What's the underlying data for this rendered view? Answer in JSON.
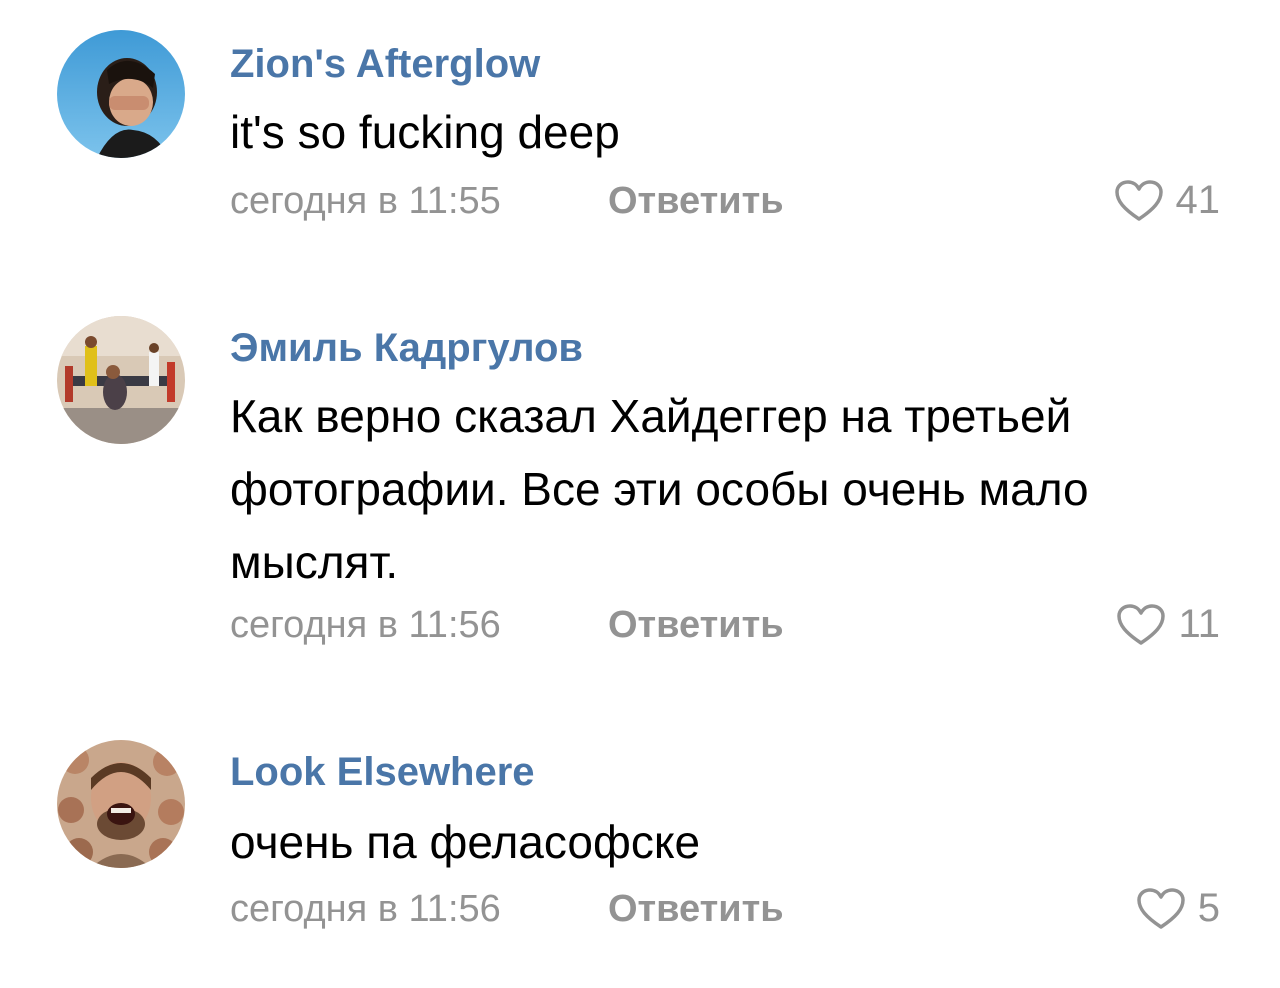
{
  "comments": [
    {
      "author": "Zion's Afterglow",
      "text": "it's so fucking deep",
      "time": "сегодня в 11:55",
      "reply_label": "Ответить",
      "likes": "41",
      "avatar": "avatar-photo-person-covering-face"
    },
    {
      "author": "Эмиль Кадргулов",
      "text": "Как верно сказал Хайдеггер на третьей фотографии. Все эти особы очень мало мыслят.",
      "time": "сегодня в 11:56",
      "reply_label": "Ответить",
      "likes": "11",
      "avatar": "avatar-photo-gym-powerlifting"
    },
    {
      "author": "Look Elsewhere",
      "text": "очень па феласофске",
      "time": "сегодня в 11:56",
      "reply_label": "Ответить",
      "likes": "5",
      "avatar": "avatar-photo-laughing-man-collage"
    }
  ],
  "colors": {
    "author": "#4a76a8",
    "meta": "#939393",
    "text": "#000000",
    "background": "#ffffff"
  },
  "icons": {
    "like": "heart-outline-icon"
  }
}
